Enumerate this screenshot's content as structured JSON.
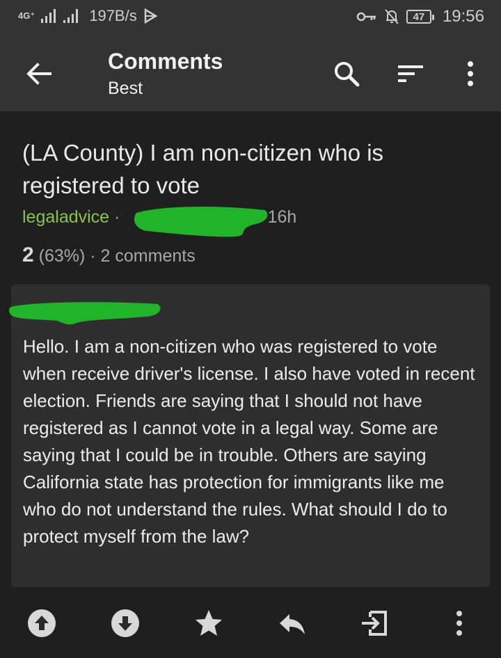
{
  "status_bar": {
    "network": "4G⁺",
    "speed": "197B/s",
    "battery": "47",
    "time": "19:56"
  },
  "app_bar": {
    "title": "Comments",
    "subtitle": "Best",
    "icons": [
      "back-arrow-icon",
      "search-icon",
      "sort-icon",
      "more-vert-icon"
    ]
  },
  "post": {
    "title": "(LA County) I am non-citizen who is registered to vote",
    "subreddit": "legaladvice",
    "separator": " · ",
    "age": "· 16h",
    "score": "2",
    "upvote_ratio": " (63%)",
    "comments": " · 2 comments",
    "selftext": "Hello. I am a non-citizen who was registered to vote when receive driver's license. I also have voted in recent election. Friends are saying that I should not have registered as I cannot vote in a legal way. Some are saying that I could be in trouble. Others are saying California state has protection for immigrants like me who do not understand the rules. What should I do to protect myself from the law?"
  },
  "actions": [
    "upvote-icon",
    "downvote-icon",
    "save-star-icon",
    "reply-icon",
    "open-link-icon",
    "more-vert-icon"
  ],
  "colors": {
    "bar_bg": "#333333",
    "page_bg": "#1f1f1f",
    "card_bg": "#2e2e2e",
    "subreddit": "#8bc34a",
    "redaction": "#21b42b"
  }
}
